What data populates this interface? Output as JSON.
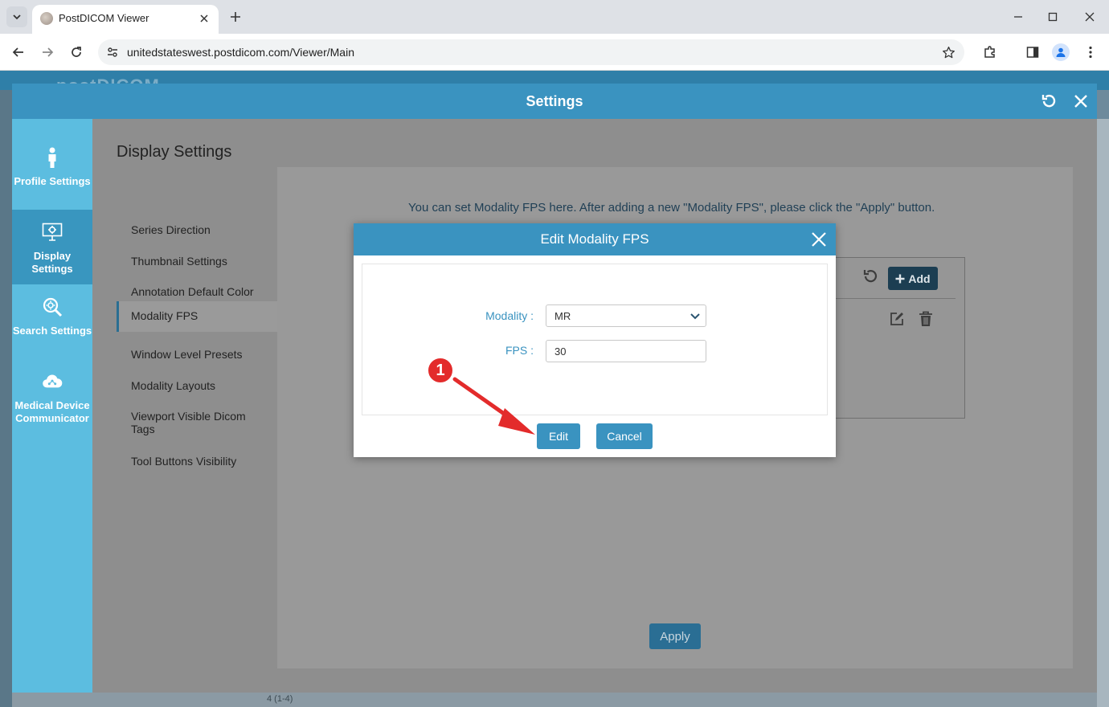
{
  "browser": {
    "tab_title": "PostDICOM Viewer",
    "url": "unitedstateswest.postdicom.com/Viewer/Main"
  },
  "app": {
    "logo_text": "postDICOM",
    "bottom_text": "4 (1-4)"
  },
  "settings": {
    "title": "Settings",
    "sidebar": [
      {
        "label": "Profile Settings",
        "icon": "person-icon"
      },
      {
        "label": "Display Settings",
        "icon": "monitor-gear-icon"
      },
      {
        "label": "Search Settings",
        "icon": "search-gear-icon"
      },
      {
        "label": "Medical Device Communicator",
        "icon": "cloud-network-icon"
      }
    ],
    "active_sidebar": "Display Settings",
    "heading": "Display Settings",
    "menu": [
      "Series Direction",
      "Thumbnail Settings",
      "Annotation Default Color",
      "Modality FPS",
      "Window Level Presets",
      "Modality Layouts",
      "Viewport Visible Dicom Tags",
      "Tool Buttons Visibility"
    ],
    "active_menu": "Modality FPS",
    "info_text": "You can set Modality FPS here. After adding a new \"Modality FPS\", please click the \"Apply\" button.",
    "add_label": "Add",
    "apply_label": "Apply"
  },
  "modal": {
    "title": "Edit Modality FPS",
    "modality_label": "Modality :",
    "modality_value": "MR",
    "fps_label": "FPS :",
    "fps_value": "30",
    "edit_label": "Edit",
    "cancel_label": "Cancel"
  },
  "annotation": {
    "step_number": "1",
    "color": "#e32b2b"
  },
  "colors": {
    "accent": "#3a93c0",
    "sidebar": "#5cbde0",
    "sidebar_active": "#3996bf"
  }
}
